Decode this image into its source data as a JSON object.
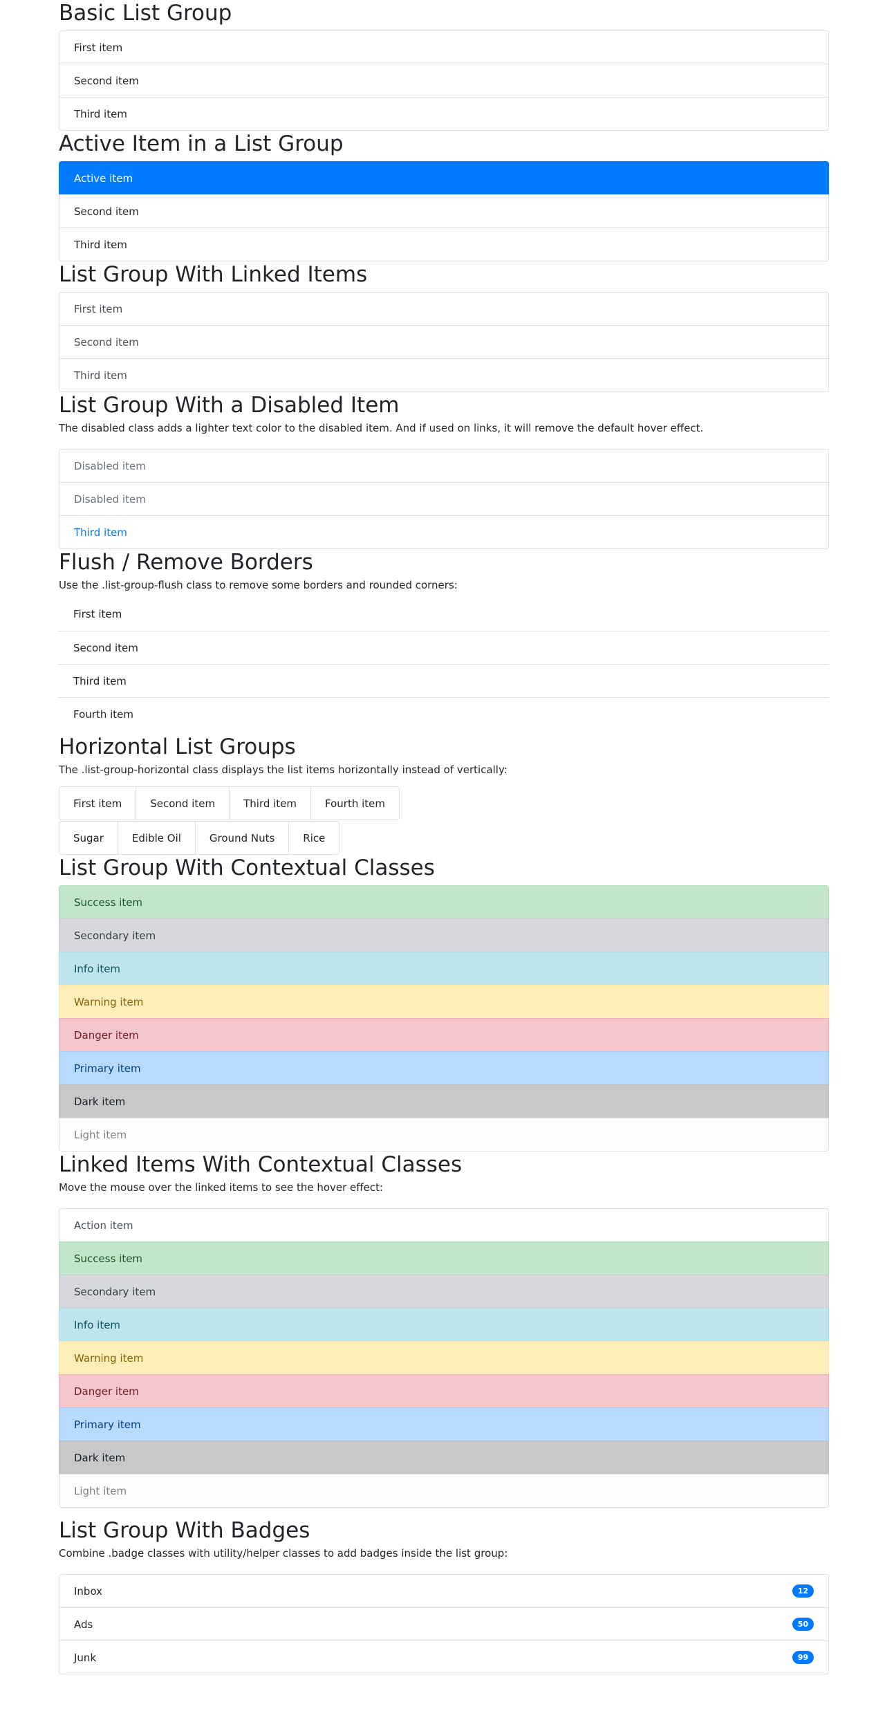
{
  "sections": {
    "basic": {
      "title": "Basic List Group",
      "items": [
        "First item",
        "Second item",
        "Third item"
      ]
    },
    "active": {
      "title": "Active Item in a List Group",
      "items": [
        "Active item",
        "Second item",
        "Third item"
      ]
    },
    "linked": {
      "title": "List Group With Linked Items",
      "items": [
        "First item",
        "Second item",
        "Third item"
      ]
    },
    "disabled": {
      "title": "List Group With a Disabled Item",
      "desc": "The disabled class adds a lighter text color to the disabled item. And if used on links, it will remove the default hover effect.",
      "items": [
        "Disabled item",
        "Disabled item",
        "Third item"
      ]
    },
    "flush": {
      "title": "Flush / Remove Borders",
      "desc": "Use the .list-group-flush class to remove some borders and rounded corners:",
      "items": [
        "First item",
        "Second item",
        "Third item",
        "Fourth item"
      ]
    },
    "horizontal": {
      "title": "Horizontal List Groups",
      "desc": "The .list-group-horizontal class displays the list items horizontally instead of vertically:",
      "row1": [
        "First item",
        "Second item",
        "Third item",
        "Fourth item"
      ],
      "row2": [
        "Sugar",
        "Edible Oil",
        "Ground Nuts",
        "Rice"
      ]
    },
    "contextual": {
      "title": "List Group With Contextual Classes",
      "items": [
        "Success item",
        "Secondary item",
        "Info item",
        "Warning item",
        "Danger item",
        "Primary item",
        "Dark item",
        "Light item"
      ]
    },
    "linked_contextual": {
      "title": "Linked Items With Contextual Classes",
      "desc": "Move the mouse over the linked items to see the hover effect:",
      "items": [
        "Action item",
        "Success item",
        "Secondary item",
        "Info item",
        "Warning item",
        "Danger item",
        "Primary item",
        "Dark item",
        "Light item"
      ]
    },
    "badges": {
      "title": "List Group With Badges",
      "desc": "Combine .badge classes with utility/helper classes to add badges inside the list group:",
      "items": [
        {
          "label": "Inbox",
          "badge": "12"
        },
        {
          "label": "Ads",
          "badge": "50"
        },
        {
          "label": "Junk",
          "badge": "99"
        }
      ]
    }
  },
  "colors": {
    "active": "#007bff",
    "success": "#c3e6cb",
    "secondary": "#d6d8db",
    "info": "#bee5eb",
    "warning": "#ffeeba",
    "danger": "#f5c6cb",
    "primary": "#b8daff",
    "dark": "#c6c8ca",
    "light": "#fdfdfe"
  }
}
